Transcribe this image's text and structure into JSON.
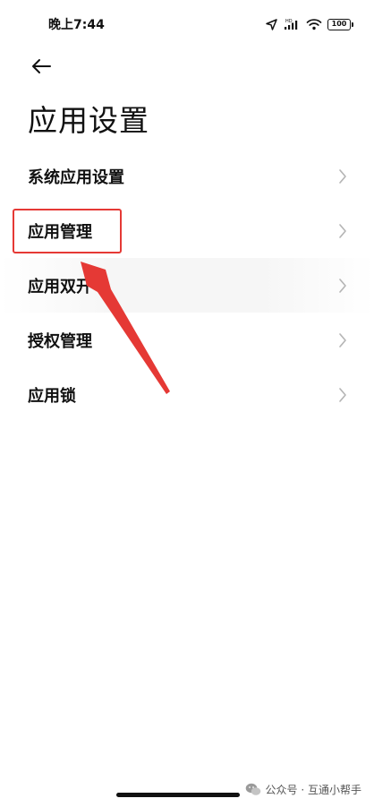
{
  "status_bar": {
    "time": "晚上7:44",
    "battery": "100"
  },
  "header": {
    "back_icon": "arrow-left-icon",
    "title": "应用设置"
  },
  "menu": {
    "items": [
      {
        "label": "系统应用设置"
      },
      {
        "label": "应用管理"
      },
      {
        "label": "应用双开"
      },
      {
        "label": "授权管理"
      },
      {
        "label": "应用锁"
      }
    ],
    "chevron_icon": "chevron-right-icon"
  },
  "annotation": {
    "color": "#e53935"
  },
  "watermark": {
    "text": "公众号 · 互通小帮手"
  }
}
